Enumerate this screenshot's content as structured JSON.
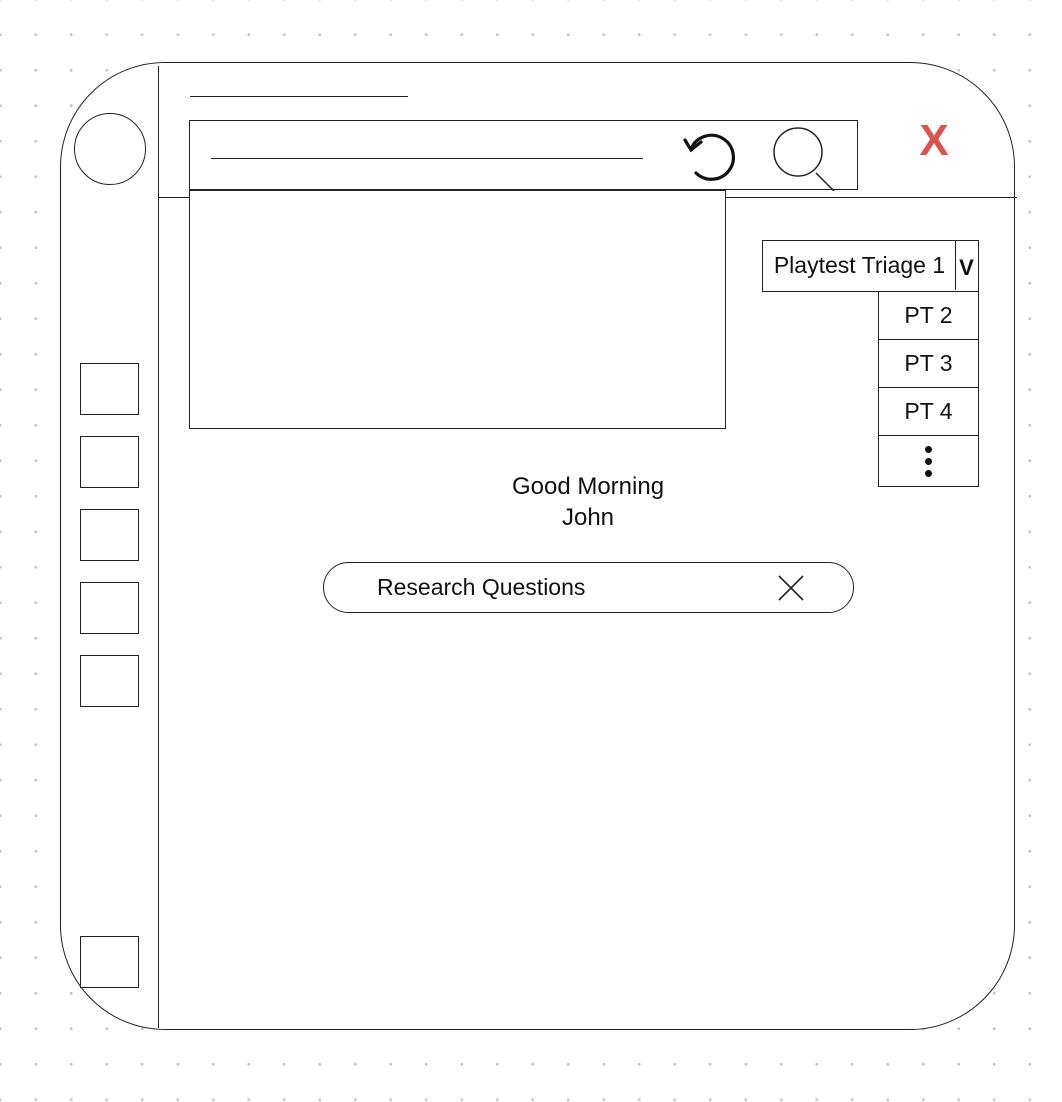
{
  "window": {
    "close_label": "X",
    "close_color": "#d9534f"
  },
  "header": {
    "icons": [
      "refresh-icon",
      "search-icon"
    ]
  },
  "sidebar": {
    "icons": [
      "avatar",
      "nav-item-1",
      "nav-item-2",
      "nav-item-3",
      "nav-item-4",
      "nav-item-5",
      "settings-item"
    ]
  },
  "playtest_dropdown": {
    "selected": "Playtest Triage 1",
    "chevron": "V",
    "options": [
      "PT 2",
      "PT 3",
      "PT 4"
    ],
    "more_icon": "more-vertical-icon"
  },
  "greeting": {
    "line1": "Good Morning",
    "line2": "John"
  },
  "research_chip": {
    "label": "Research Questions",
    "close_icon": "close-icon"
  }
}
